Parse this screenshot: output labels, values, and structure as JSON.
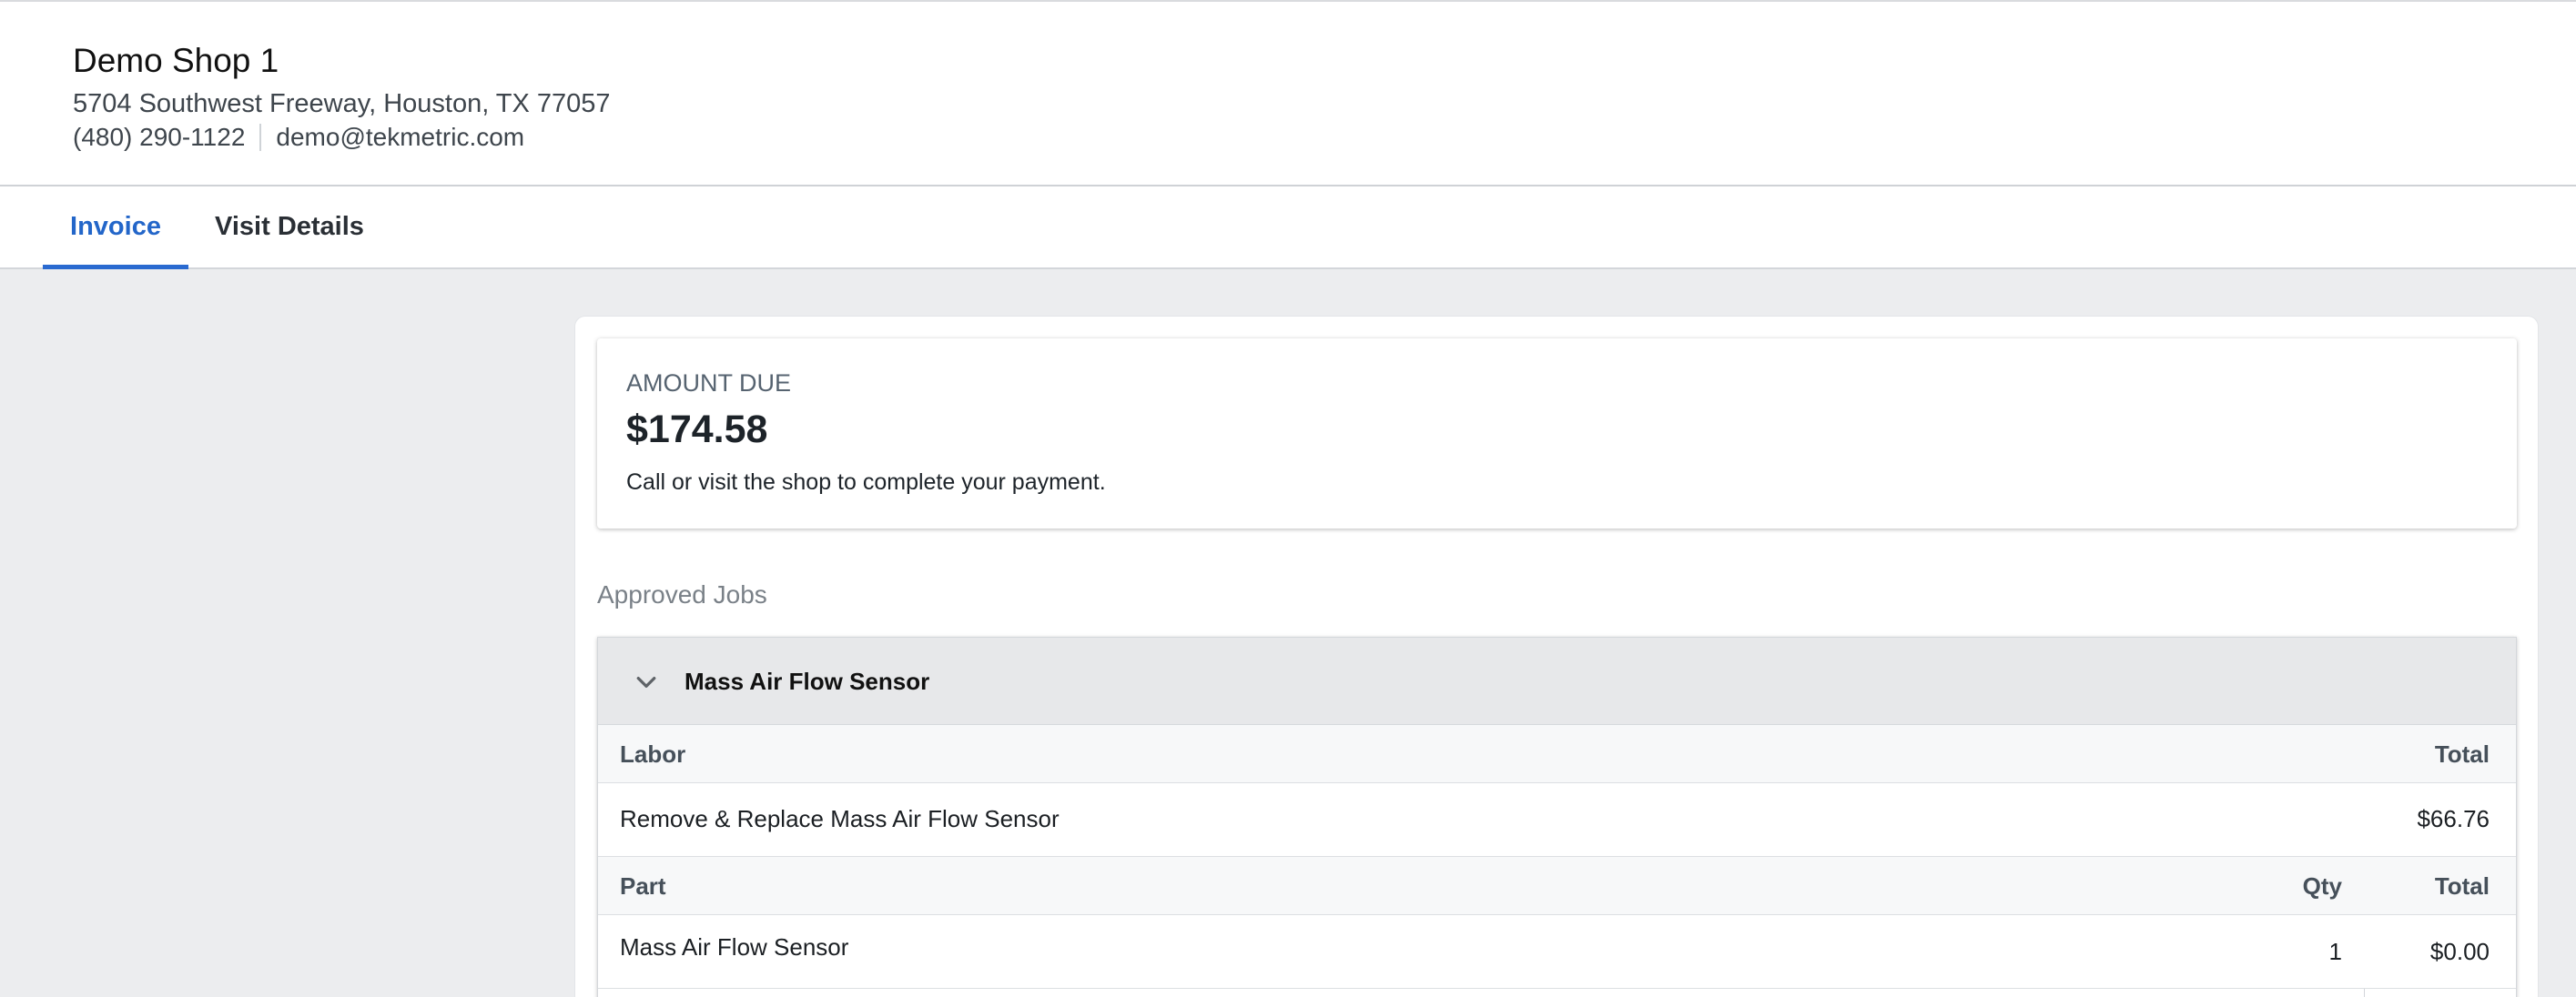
{
  "shop": {
    "name": "Demo Shop 1",
    "address": "5704 Southwest Freeway, Houston, TX 77057",
    "phone": "(480) 290-1122",
    "email": "demo@tekmetric.com"
  },
  "tabs": [
    {
      "label": "Invoice",
      "active": true
    },
    {
      "label": "Visit Details",
      "active": false
    }
  ],
  "amount_due": {
    "label": "AMOUNT DUE",
    "value": "$174.58",
    "note": "Call or visit the shop to complete your payment."
  },
  "approved_jobs": {
    "title": "Approved Jobs",
    "job": {
      "name": "Mass Air Flow Sensor",
      "labor": {
        "header": {
          "name": "Labor",
          "total": "Total"
        },
        "items": [
          {
            "name": "Remove & Replace Mass Air Flow Sensor",
            "total": "$66.76"
          }
        ]
      },
      "parts": {
        "header": {
          "name": "Part",
          "qty": "Qty",
          "total": "Total"
        },
        "items": [
          {
            "name": "Mass Air Flow Sensor",
            "qty": "1",
            "total": "$0.00"
          }
        ]
      }
    }
  },
  "colors": {
    "accent": "#2366c9",
    "background": "#ecedef",
    "job_header_bg": "#e7e8ea"
  },
  "icons": {
    "collapse": "chevron-down-icon"
  }
}
